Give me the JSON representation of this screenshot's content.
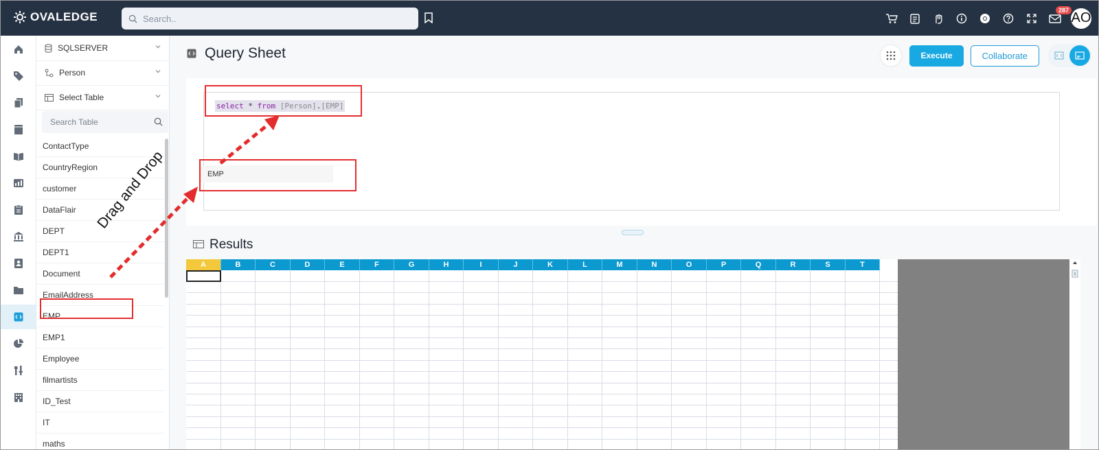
{
  "app": {
    "brand": "OVALEDGE",
    "search_placeholder": "Search..",
    "notifications_count": "287",
    "user_initials": "AO"
  },
  "rail": {
    "icons": [
      "home-icon",
      "tag-icon",
      "copy-icon",
      "book-icon",
      "open-book-icon",
      "dashboard-icon",
      "clipboard-icon",
      "bank-icon",
      "contact-card-icon",
      "folder-icon",
      "query-sheet-icon",
      "chart-pie-icon",
      "tools-icon",
      "building-icon"
    ],
    "active_index": 10
  },
  "table_panel": {
    "connector": "SQLSERVER",
    "schema": "Person",
    "table_select": "Select Table",
    "search_placeholder": "Search Table",
    "tables": [
      "ContactType",
      "CountryRegion",
      "customer",
      "DataFlair",
      "DEPT",
      "DEPT1",
      "Document",
      "EmailAddress",
      "EMP",
      "EMP1",
      "Employee",
      "filmartists",
      "ID_Test",
      "IT",
      "maths"
    ]
  },
  "main": {
    "title": "Query Sheet",
    "execute_label": "Execute",
    "collaborate_label": "Collaborate",
    "query": {
      "kw1": "select",
      "star": " * ",
      "kw2": "from",
      "schema": "[Person]",
      "dot": ".",
      "table": "[EMP]"
    },
    "dragged_item": "EMP",
    "results_title": "Results",
    "columns": [
      "A",
      "B",
      "C",
      "D",
      "E",
      "F",
      "G",
      "H",
      "I",
      "J",
      "K",
      "L",
      "M",
      "N",
      "O",
      "P",
      "Q",
      "R",
      "S",
      "T"
    ]
  },
  "annotation": {
    "label": "Drag and Drop",
    "color": "#e42c2c"
  }
}
